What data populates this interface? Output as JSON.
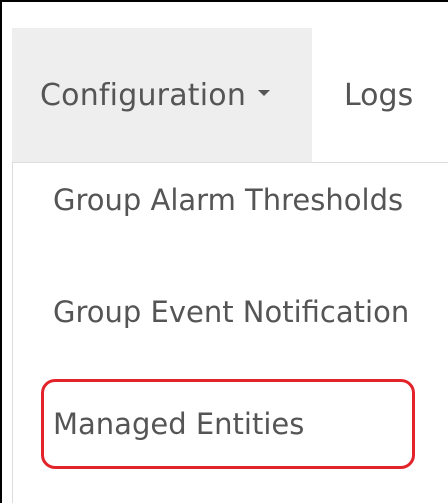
{
  "navbar": {
    "configuration_label": "Configuration",
    "logs_label": "Logs"
  },
  "dropdown": {
    "items": [
      {
        "label": "Group Alarm Thresholds"
      },
      {
        "label": "Group Event Notification"
      },
      {
        "label": "Managed Entities"
      }
    ]
  },
  "colors": {
    "nav_active_bg": "#eeeeee",
    "text": "#555555",
    "highlight_border": "#e3232a"
  }
}
